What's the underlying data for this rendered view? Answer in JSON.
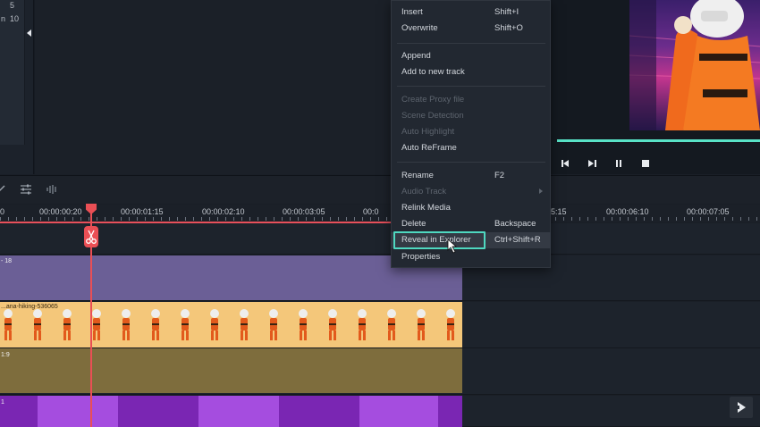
{
  "media_panel": {
    "line1": "5",
    "line2_prefix": "n",
    "line2_value": "10"
  },
  "timeline": {
    "ruler_labels": [
      "0",
      "00:00:00:20",
      "00:00:01:15",
      "00:00:02:10",
      "00:00:03:05",
      "00:0",
      "5:15",
      "00:00:06:10",
      "00:00:07:05"
    ],
    "tracks": {
      "track1_label": "- 18",
      "track2_label": "...ana-hiking-536065",
      "track3_label": "1:9",
      "track4_label": "1"
    }
  },
  "context_menu": {
    "items": [
      {
        "label": "Insert",
        "shortcut": "Shift+I",
        "enabled": true
      },
      {
        "label": "Overwrite",
        "shortcut": "Shift+O",
        "enabled": true
      },
      {
        "label": "Append",
        "shortcut": "",
        "enabled": true
      },
      {
        "label": "Add to new track",
        "shortcut": "",
        "enabled": true
      },
      {
        "label": "Create Proxy file",
        "shortcut": "",
        "enabled": false
      },
      {
        "label": "Scene Detection",
        "shortcut": "",
        "enabled": false
      },
      {
        "label": "Auto Highlight",
        "shortcut": "",
        "enabled": false
      },
      {
        "label": "Auto ReFrame",
        "shortcut": "",
        "enabled": true
      },
      {
        "label": "Rename",
        "shortcut": "F2",
        "enabled": true
      },
      {
        "label": "Audio Track",
        "shortcut": "",
        "enabled": false,
        "has_submenu": true
      },
      {
        "label": "Relink Media",
        "shortcut": "",
        "enabled": true
      },
      {
        "label": "Delete",
        "shortcut": "Backspace",
        "enabled": true
      },
      {
        "label": "Reveal in Explorer",
        "shortcut": "Ctrl+Shift+R",
        "enabled": true,
        "hovered": true
      },
      {
        "label": "Properties",
        "shortcut": "",
        "enabled": true
      }
    ]
  },
  "colors": {
    "accent": "#4fd8c0",
    "playhead": "#ea4f55",
    "progress": "#58e2c6"
  }
}
